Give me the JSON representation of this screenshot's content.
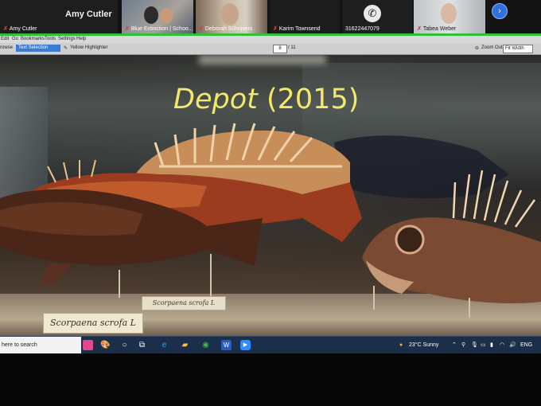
{
  "participants": {
    "host_big_name": "Amy Cutler",
    "tiles": [
      {
        "name": "Amy Cutler",
        "muted": true
      },
      {
        "name": "Blue Extinction | Schoo...",
        "muted": true
      },
      {
        "name": "Deborah Schrijvers",
        "muted": true
      },
      {
        "name": "Karim Townsend",
        "muted": true
      },
      {
        "name": "31622447079",
        "muted": false,
        "icon": "phone-icon"
      },
      {
        "name": "Tabea Weber",
        "muted": true
      }
    ],
    "next_page_icon": "chevron-right-icon"
  },
  "viewer": {
    "menu": [
      "Edit",
      "Go",
      "Bookmarks",
      "Tools",
      "Settings",
      "Help"
    ],
    "toolbar": {
      "browse": "rowse",
      "text_selection": "Text Selection",
      "highlighter": "Yellow Highlighter",
      "page_current": "8",
      "page_total": "/ 11",
      "zoom_out": "Zoom Out",
      "fit": "Fit Width"
    }
  },
  "slide": {
    "title_italic": "Depot",
    "title_rest": "(2015)",
    "label_main": "Scorpaena scrofa L",
    "label_back": "Scorpaena scrofa L"
  },
  "taskbar": {
    "search_placeholder": "here to search",
    "weather": "23°C  Sunny",
    "language": "ENG"
  },
  "colors": {
    "share_border": "#2fbf3a",
    "title_yellow": "#f2e86a",
    "taskbar": "#1c2f4a",
    "accent_blue": "#2f6fe0"
  }
}
